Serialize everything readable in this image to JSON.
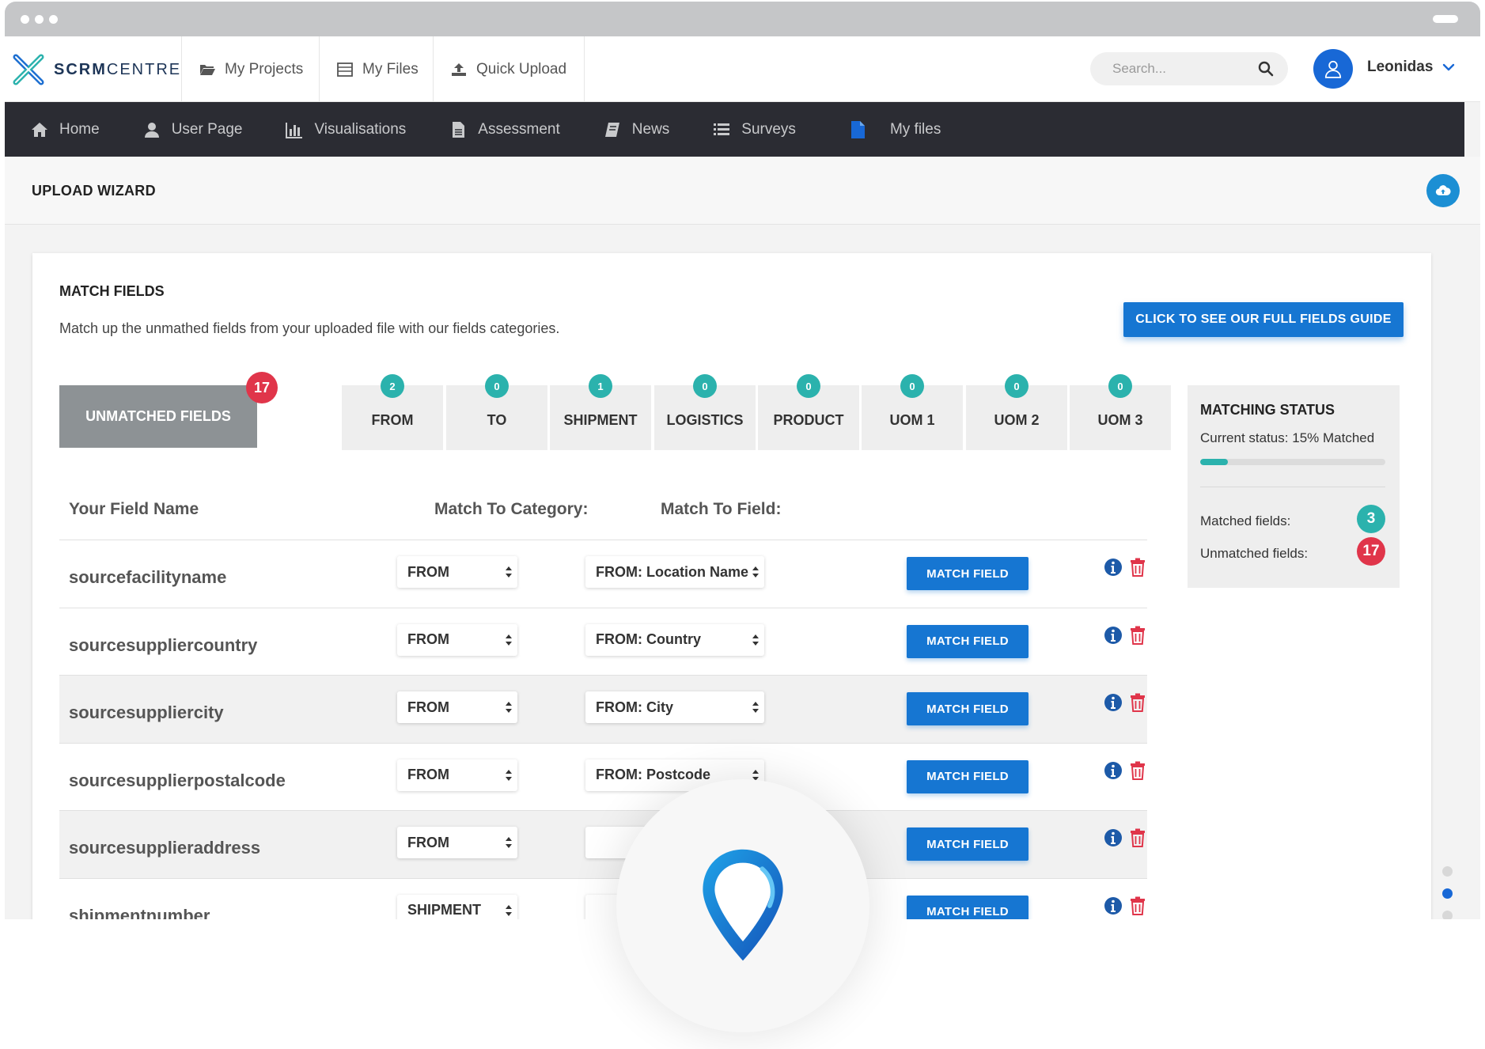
{
  "app": {
    "logo_bold": "SCRM",
    "logo_light": "CENTRE"
  },
  "topbar": {
    "tabs": [
      {
        "label": "My Projects",
        "icon": "folder-open-icon"
      },
      {
        "label": "My Files",
        "icon": "files-icon"
      },
      {
        "label": "Quick Upload",
        "icon": "upload-icon"
      }
    ],
    "search_placeholder": "Search...",
    "user_name": "Leonidas"
  },
  "nav": {
    "items": [
      {
        "label": "Home",
        "icon": "home-icon"
      },
      {
        "label": "User Page",
        "icon": "user-icon"
      },
      {
        "label": "Visualisations",
        "icon": "bar-chart-icon"
      },
      {
        "label": "Assessment",
        "icon": "document-icon"
      },
      {
        "label": "News",
        "icon": "book-icon"
      },
      {
        "label": "Surveys",
        "icon": "list-icon"
      },
      {
        "label": "My files",
        "icon": "file-icon"
      }
    ]
  },
  "page": {
    "title": "UPLOAD WIZARD"
  },
  "card": {
    "title": "MATCH FIELDS",
    "description": "Match up the unmathed fields from your uploaded file with our fields categories.",
    "guide_button": "CLICK TO SEE OUR FULL FIELDS GUIDE"
  },
  "tabs": {
    "unmatched": {
      "label": "UNMATCHED FIELDS",
      "count": "17"
    },
    "categories": [
      {
        "label": "FROM",
        "count": "2"
      },
      {
        "label": "TO",
        "count": "0"
      },
      {
        "label": "SHIPMENT",
        "count": "1"
      },
      {
        "label": "LOGISTICS",
        "count": "0"
      },
      {
        "label": "PRODUCT",
        "count": "0"
      },
      {
        "label": "UOM 1",
        "count": "0"
      },
      {
        "label": "UOM 2",
        "count": "0"
      },
      {
        "label": "UOM 3",
        "count": "0"
      }
    ]
  },
  "status": {
    "title": "MATCHING STATUS",
    "current_label": "Current status:",
    "current_value": "15% Matched",
    "progress_percent": 15,
    "matched_label": "Matched fields:",
    "matched_count": "3",
    "unmatched_label": "Unmatched fields:",
    "unmatched_count": "17",
    "colors": {
      "teal": "#2bb2ad",
      "red": "#e0354a"
    }
  },
  "table": {
    "headers": {
      "field_name": "Your Field Name",
      "category": "Match To Category:",
      "field": "Match To Field:"
    },
    "match_button": "MATCH FIELD",
    "rows": [
      {
        "field_name": "sourcefacilityname",
        "category": "FROM",
        "field": "FROM: Location Name"
      },
      {
        "field_name": "sourcesuppliercountry",
        "category": "FROM",
        "field": "FROM: Country"
      },
      {
        "field_name": "sourcesuppliercity",
        "category": "FROM",
        "field": "FROM: City"
      },
      {
        "field_name": "sourcesupplierpostalcode",
        "category": "FROM",
        "field": "FROM: Postcode"
      },
      {
        "field_name": "sourcesupplieraddress",
        "category": "FROM",
        "field": ""
      },
      {
        "field_name": "shipmentnumber",
        "category": "SHIPMENT",
        "field": ""
      }
    ]
  },
  "theme": {
    "accent": "#1676d2",
    "navbar": "#2b2c33"
  }
}
